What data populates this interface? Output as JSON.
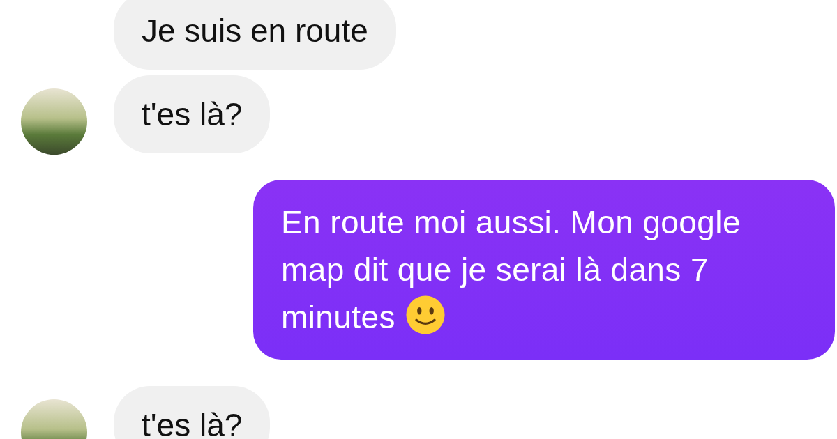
{
  "messages": [
    {
      "kind": "received",
      "text": "Je suis en route",
      "avatar": false
    },
    {
      "kind": "received",
      "text": "t'es là?",
      "avatar": true
    },
    {
      "kind": "sent",
      "text": "En route moi aussi. Mon google map dit que je serai là dans 7 minutes"
    },
    {
      "kind": "received",
      "text": "t'es là?",
      "avatar": true
    }
  ]
}
